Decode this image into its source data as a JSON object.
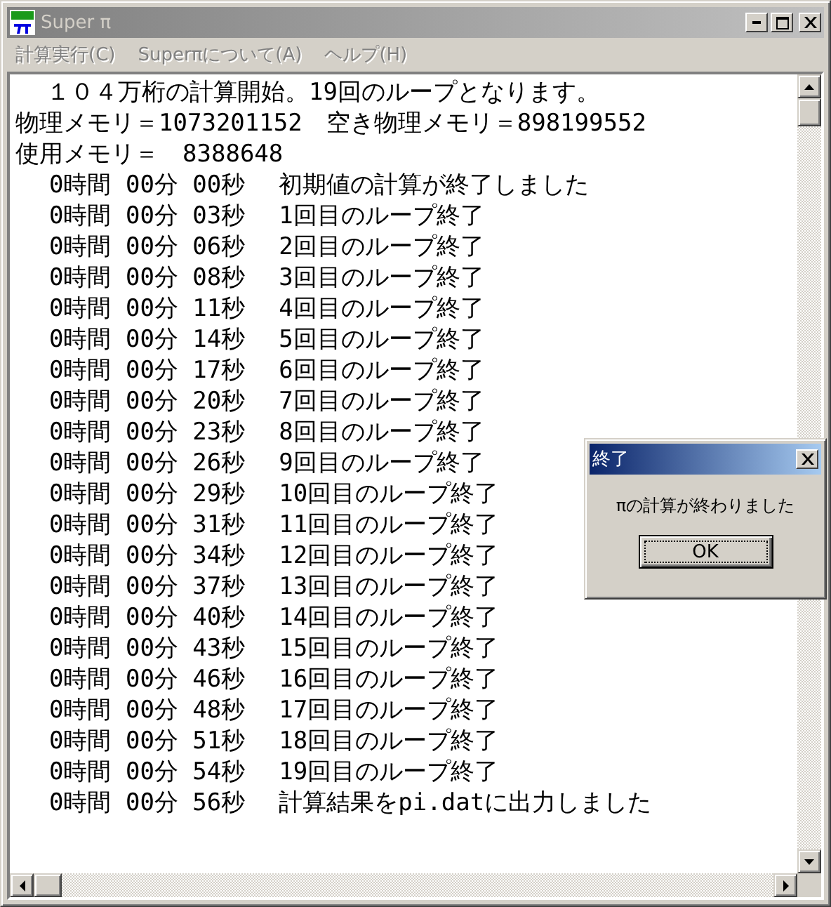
{
  "window": {
    "title": "Super π",
    "active": false
  },
  "menu": [
    {
      "label": "計算実行(C)",
      "disabled": true
    },
    {
      "label": "Superπについて(A)",
      "disabled": true
    },
    {
      "label": "ヘルプ(H)",
      "disabled": true
    }
  ],
  "log": [
    {
      "kind": "header",
      "text": "１０４万桁の計算開始。19回のループとなります。"
    },
    {
      "kind": "info",
      "text": "物理メモリ＝1073201152　空き物理メモリ＝898199552"
    },
    {
      "kind": "info",
      "text": "使用メモリ＝　8388648"
    },
    {
      "kind": "progress",
      "time": "0時間 00分 00秒",
      "text": "初期値の計算が終了しました"
    },
    {
      "kind": "progress",
      "time": "0時間 00分 03秒",
      "text": "1回目のループ終了"
    },
    {
      "kind": "progress",
      "time": "0時間 00分 06秒",
      "text": "2回目のループ終了"
    },
    {
      "kind": "progress",
      "time": "0時間 00分 08秒",
      "text": "3回目のループ終了"
    },
    {
      "kind": "progress",
      "time": "0時間 00分 11秒",
      "text": "4回目のループ終了"
    },
    {
      "kind": "progress",
      "time": "0時間 00分 14秒",
      "text": "5回目のループ終了"
    },
    {
      "kind": "progress",
      "time": "0時間 00分 17秒",
      "text": "6回目のループ終了"
    },
    {
      "kind": "progress",
      "time": "0時間 00分 20秒",
      "text": "7回目のループ終了"
    },
    {
      "kind": "progress",
      "time": "0時間 00分 23秒",
      "text": "8回目のループ終了"
    },
    {
      "kind": "progress",
      "time": "0時間 00分 26秒",
      "text": "9回目のループ終了"
    },
    {
      "kind": "progress",
      "time": "0時間 00分 29秒",
      "text": "10回目のループ終了"
    },
    {
      "kind": "progress",
      "time": "0時間 00分 31秒",
      "text": "11回目のループ終了"
    },
    {
      "kind": "progress",
      "time": "0時間 00分 34秒",
      "text": "12回目のループ終了"
    },
    {
      "kind": "progress",
      "time": "0時間 00分 37秒",
      "text": "13回目のループ終了"
    },
    {
      "kind": "progress",
      "time": "0時間 00分 40秒",
      "text": "14回目のループ終了"
    },
    {
      "kind": "progress",
      "time": "0時間 00分 43秒",
      "text": "15回目のループ終了"
    },
    {
      "kind": "progress",
      "time": "0時間 00分 46秒",
      "text": "16回目のループ終了"
    },
    {
      "kind": "progress",
      "time": "0時間 00分 48秒",
      "text": "17回目のループ終了"
    },
    {
      "kind": "progress",
      "time": "0時間 00分 51秒",
      "text": "18回目のループ終了"
    },
    {
      "kind": "progress",
      "time": "0時間 00分 54秒",
      "text": "19回目のループ終了"
    },
    {
      "kind": "progress",
      "time": "0時間 00分 56秒",
      "text": "計算結果をpi.datに出力しました"
    }
  ],
  "dialog": {
    "title": "終了",
    "active": true,
    "message": "πの計算が終わりました",
    "button": "OK"
  }
}
